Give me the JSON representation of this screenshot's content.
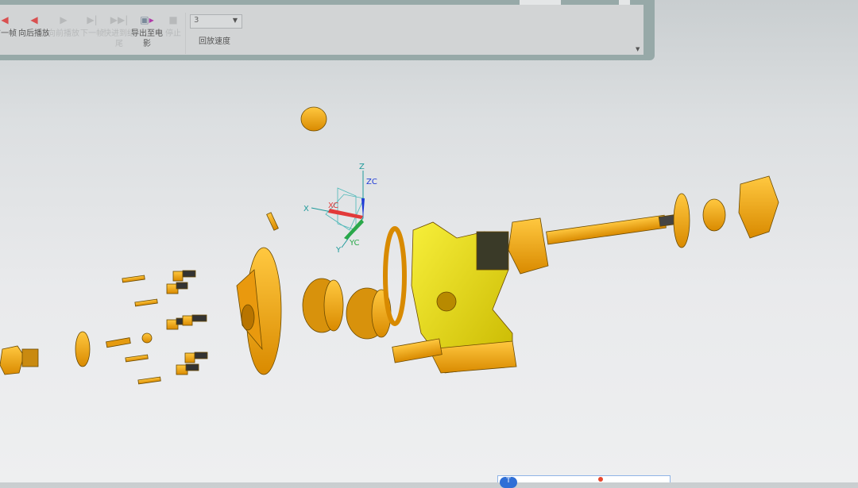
{
  "toolbar": {
    "buttons": [
      {
        "label": "前一帧",
        "icon": "prev-frame-icon",
        "enabled": true
      },
      {
        "label": "向后播放",
        "icon": "play-backward-icon",
        "enabled": true
      },
      {
        "label": "向前播放",
        "icon": "play-forward-icon",
        "enabled": false
      },
      {
        "label": "下一帧",
        "icon": "next-frame-icon",
        "enabled": false
      },
      {
        "label": "快进到结尾",
        "icon": "fast-forward-icon",
        "enabled": false
      },
      {
        "label": "导出至电影",
        "icon": "export-movie-icon",
        "enabled": true
      },
      {
        "label": "停止",
        "icon": "stop-icon",
        "enabled": false
      }
    ],
    "speed_value": "3",
    "speed_label": "回放速度"
  },
  "csys": {
    "z": "Z",
    "zc": "ZC",
    "x": "X",
    "xc": "XC",
    "y": "Y",
    "yc": "YC"
  },
  "taskbar": {
    "ime": "T"
  },
  "colors": {
    "part": "#f2a51a",
    "housing": "#e8e21a",
    "xc": "#e23a3a",
    "zc": "#1f3bd6",
    "yc": "#2aa84a",
    "axis": "#1e9a9a"
  }
}
